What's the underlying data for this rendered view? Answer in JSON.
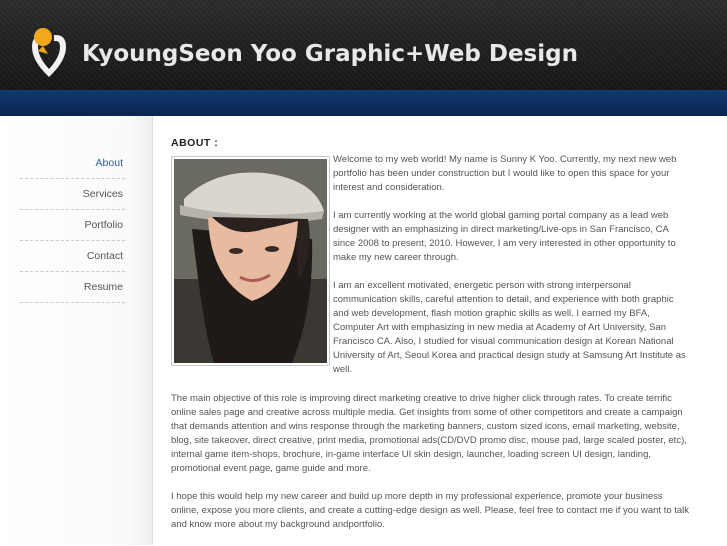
{
  "site": {
    "title": "KyoungSeon Yoo Graphic+Web Design",
    "colors": {
      "header": "#1e1e1e",
      "band": "#0f3266",
      "accent_yellow": "#f2a81c",
      "link": "#2f5da6"
    }
  },
  "nav": {
    "items": [
      {
        "label": "About",
        "active": true
      },
      {
        "label": "Services",
        "active": false
      },
      {
        "label": "Portfolio",
        "active": false
      },
      {
        "label": "Contact",
        "active": false
      },
      {
        "label": "Resume",
        "active": false
      }
    ]
  },
  "about": {
    "heading": "ABOUT :",
    "intro_paragraphs": [
      "Welcome to my web world! My name is Sunny K Yoo. Currently, my next new web portfolio has been under construction but I would like to open this space for your interest and consideration.",
      "I am currently working at the world global gaming portal company as a lead web designer with an emphasizing in direct marketing/Live-ops in San Francisco, CA since 2008 to present, 2010. However, I am very interested in other opportunity to make my new career through.",
      "I am an excellent motivated, energetic person with strong interpersonal communication skills, careful attention to detail, and experience with both graphic and web development, flash motion graphic skills as well. I earned my BFA, Computer Art with emphasizing in new media at Academy of Art University, San Francisco CA. Also, I studied for visual communication design at Korean National University of Art, Seoul Korea and practical design study at Samsung Art Institute as well."
    ],
    "full_paragraphs": [
      "The main objective of this role is improving direct marketing creative to drive higher click through rates. To create terrific online sales page and creative across multiple media. Get insights from some of other competitors and create a campaign that demands attention and wins response through the marketing banners, custom sized icons, email marketing, website, blog, site takeover, direct creative, print media, promotional ads(CD/DVD promo disc, mouse pad, large scaled poster, etc), internal game item-shops, brochure, in-game interface UI skin design, launcher, loading screen UI design, landing, promotional event page, game guide and more.",
      "I hope this would help my new career and build up more depth in my professional experience, promote your business online, expose you more clients, and create a cutting-edge design as well. Please, feel free to contact me if you want to talk and know more about my background andportfolio."
    ]
  }
}
